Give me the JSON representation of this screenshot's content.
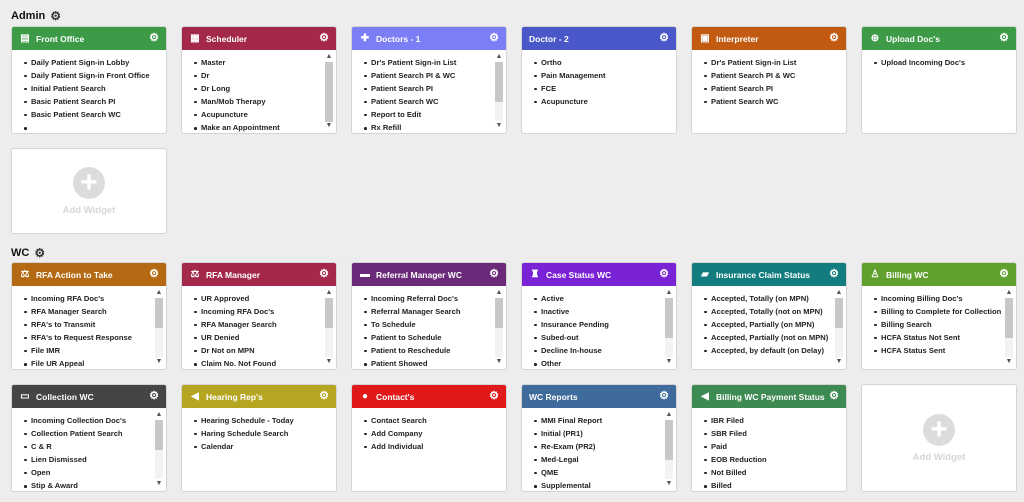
{
  "sections": {
    "admin": {
      "title": "Admin"
    },
    "wc": {
      "title": "WC"
    }
  },
  "add_widget_label": "Add Widget",
  "widgets": {
    "front_office": {
      "title": "Front Office",
      "color": "#3d9a47",
      "icon": "id-card-icon",
      "items": [
        "Daily Patient Sign-in Lobby",
        "Daily Patient Sign-in Front Office",
        "Initial Patient Search",
        "Basic Patient Search PI",
        "Basic Patient Search WC",
        ""
      ]
    },
    "scheduler": {
      "title": "Scheduler",
      "color": "#a3284a",
      "icon": "building-icon",
      "items": [
        "Master",
        "Dr",
        "Dr Long",
        "Man/Mob Therapy",
        "Acupuncture",
        "Make an Appointment"
      ]
    },
    "doctors1": {
      "title": "Doctors - 1",
      "color": "#7b7ef5",
      "icon": "medkit-icon",
      "items": [
        "Dr's Patient Sign-in List",
        "Patient Search PI & WC",
        "Patient Search PI",
        "Patient Search WC",
        "Report to Edit",
        "Rx Refill"
      ]
    },
    "doctor2": {
      "title": "Doctor - 2",
      "color": "#4a57c9",
      "icon": "",
      "items": [
        "Ortho",
        "Pain Management",
        "FCE",
        "Acupuncture"
      ]
    },
    "interpreter": {
      "title": "Interpreter",
      "color": "#c25a12",
      "icon": "briefcase-icon",
      "items": [
        "Dr's Patient Sign-in List",
        "Patient Search PI & WC",
        "Patient Search PI",
        "Patient Search WC"
      ]
    },
    "upload_docs": {
      "title": "Upload Doc's",
      "color": "#3d9a47",
      "icon": "plus-circle-icon",
      "items": [
        "Upload Incoming Doc's"
      ]
    },
    "rfa_action": {
      "title": "RFA Action to Take",
      "color": "#b46a12",
      "icon": "scale-icon",
      "items": [
        "Incoming RFA Doc's",
        "RFA Manager Search",
        "RFA's to Transmit",
        "RFA's to Request Response",
        "File IMR",
        "File UR Appeal"
      ]
    },
    "rfa_manager": {
      "title": "RFA Manager",
      "color": "#a3284a",
      "icon": "scale-icon",
      "items": [
        "UR Approved",
        "Incoming RFA Doc's",
        "RFA Manager Search",
        "UR Denied",
        "Dr Not on MPN",
        "Claim No. Not Found"
      ]
    },
    "referral_manager": {
      "title": "Referral Manager WC",
      "color": "#6b2a79",
      "icon": "bed-icon",
      "items": [
        "Incoming Referral Doc's",
        "Referral Manager Search",
        "To Schedule",
        "Patient to Schedule",
        "Patient to Reschedule",
        "Patient Showed"
      ]
    },
    "case_status": {
      "title": "Case Status WC",
      "color": "#7a22d6",
      "icon": "trophy-icon",
      "items": [
        "Active",
        "Inactive",
        "Insurance Pending",
        "Subed-out",
        "Decline In-house",
        "Other"
      ]
    },
    "insurance_claim": {
      "title": "Insurance Claim Status",
      "color": "#127c7e",
      "icon": "truck-icon",
      "items": [
        "Accepted, Totally (on MPN)",
        "Accepted, Totally (not on MPN)",
        "Accepted, Partially (on MPN)",
        "Accepted, Partially (not on MPN)",
        "Accepted, by default (on Delay)"
      ]
    },
    "billing_wc": {
      "title": "Billing WC",
      "color": "#5fa02e",
      "icon": "walking-icon",
      "items": [
        "Incoming Billing Doc's",
        "Billing to Complete for Collection",
        "Billing Search",
        "HCFA Status Not Sent",
        "HCFA Status Sent"
      ]
    },
    "collection_wc": {
      "title": "Collection WC",
      "color": "#454545",
      "icon": "folder-icon",
      "items": [
        "Incoming Collection Doc's",
        "Collection Patient Search",
        "C & R",
        "Lien Dismissed",
        "Open",
        "Stip & Award"
      ]
    },
    "hearing_reps": {
      "title": "Hearing Rep's",
      "color": "#b6a520",
      "icon": "bullhorn-icon",
      "items": [
        "Hearing Schedule - Today",
        "Haring Schedule Search",
        "Calendar"
      ]
    },
    "contacts": {
      "title": "Contact's",
      "color": "#e01a1a",
      "icon": "apple-icon",
      "items": [
        "Contact Search",
        "Add Company",
        "Add Individual"
      ]
    },
    "wc_reports": {
      "title": "WC Reports",
      "color": "#3f6b9c",
      "icon": "",
      "items": [
        "MMI Final Report",
        "Initial (PR1)",
        "Re-Exam (PR2)",
        "Med-Legal",
        "QME",
        "Supplemental"
      ]
    },
    "billing_payment": {
      "title": "Billing WC Payment Status",
      "color": "#3d8a52",
      "icon": "bullhorn-icon",
      "items": [
        "IBR Filed",
        "SBR Filed",
        "Paid",
        "EOB Reduction",
        "Not Billed",
        "Billed"
      ]
    }
  }
}
